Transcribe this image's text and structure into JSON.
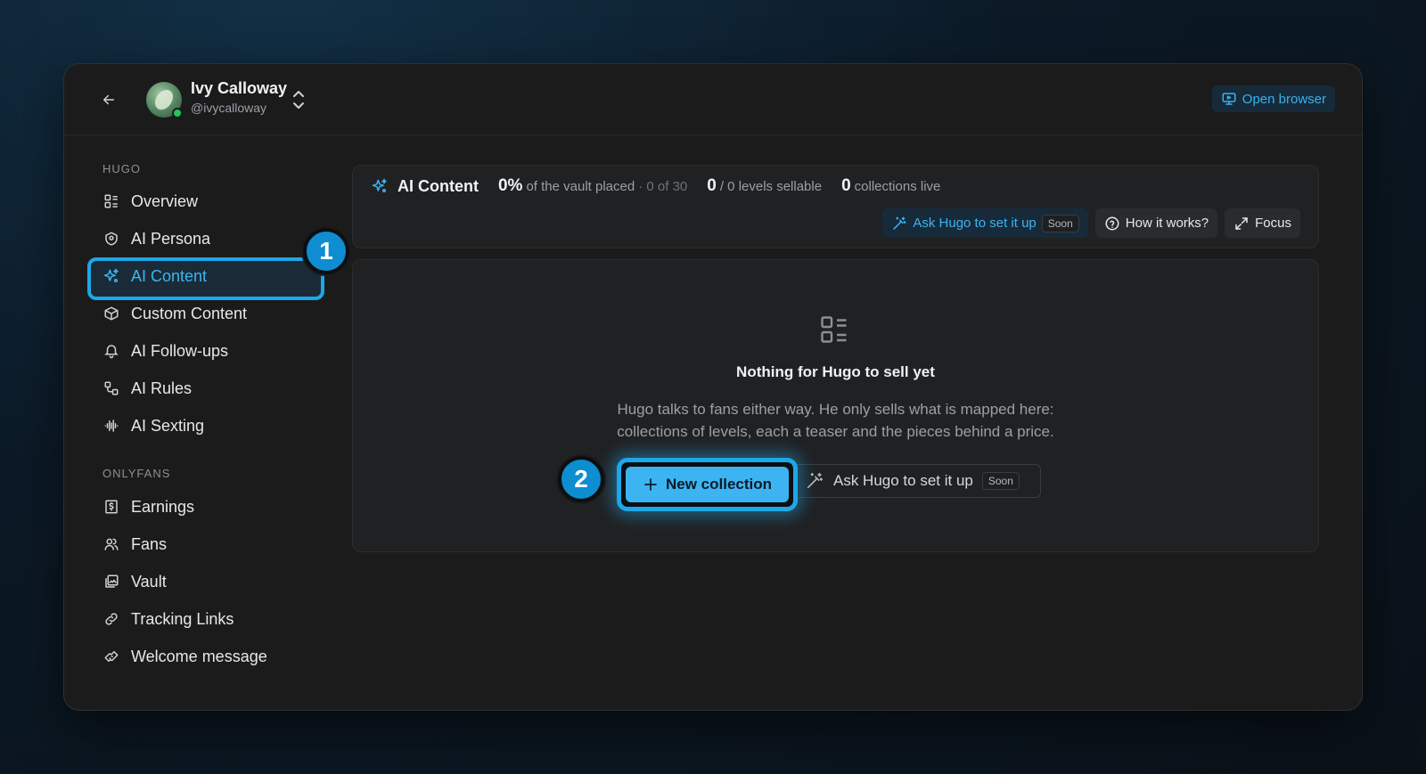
{
  "user": {
    "name": "Ivy Calloway",
    "handle": "@ivycalloway",
    "status": "online"
  },
  "header": {
    "open_browser_label": "Open browser"
  },
  "sidebar": {
    "sections": [
      {
        "title": "HUGO",
        "items": [
          {
            "label": "Overview",
            "icon": "overview-icon"
          },
          {
            "label": "AI Persona",
            "icon": "persona-icon"
          },
          {
            "label": "AI Content",
            "icon": "sparkles-icon",
            "active": true
          },
          {
            "label": "Custom Content",
            "icon": "box-icon"
          },
          {
            "label": "AI Follow-ups",
            "icon": "bell-icon"
          },
          {
            "label": "AI Rules",
            "icon": "rules-icon"
          },
          {
            "label": "AI Sexting",
            "icon": "waveform-icon"
          }
        ]
      },
      {
        "title": "ONLYFANS",
        "items": [
          {
            "label": "Earnings",
            "icon": "dollar-icon"
          },
          {
            "label": "Fans",
            "icon": "users-icon"
          },
          {
            "label": "Vault",
            "icon": "vault-icon"
          },
          {
            "label": "Tracking Links",
            "icon": "link-icon"
          },
          {
            "label": "Welcome message",
            "icon": "handshake-icon"
          }
        ]
      }
    ]
  },
  "stats": {
    "title": "AI Content",
    "vault_pct": "0%",
    "vault_label": "of the vault placed",
    "vault_detail": "· 0 of 30",
    "levels_value": "0",
    "levels_label": "/ 0 levels sellable",
    "collections_value": "0",
    "collections_label": "collections live"
  },
  "actions": {
    "ask_hugo_label": "Ask Hugo to set it up",
    "soon_label": "Soon",
    "how_it_works_label": "How it works?",
    "focus_label": "Focus"
  },
  "empty_state": {
    "title": "Nothing for Hugo to sell yet",
    "description_line1": "Hugo talks to fans either way. He only sells what is mapped here:",
    "description_line2": "collections of levels, each a teaser and the pieces behind a price.",
    "new_collection_label": "New collection",
    "ask_hugo_label": "Ask Hugo to set it up",
    "soon_label": "Soon"
  },
  "annotations": {
    "step1": "1",
    "step2": "2"
  },
  "colors": {
    "accent": "#3db4f2",
    "highlight": "#1ea7e8",
    "online": "#22c55e"
  }
}
